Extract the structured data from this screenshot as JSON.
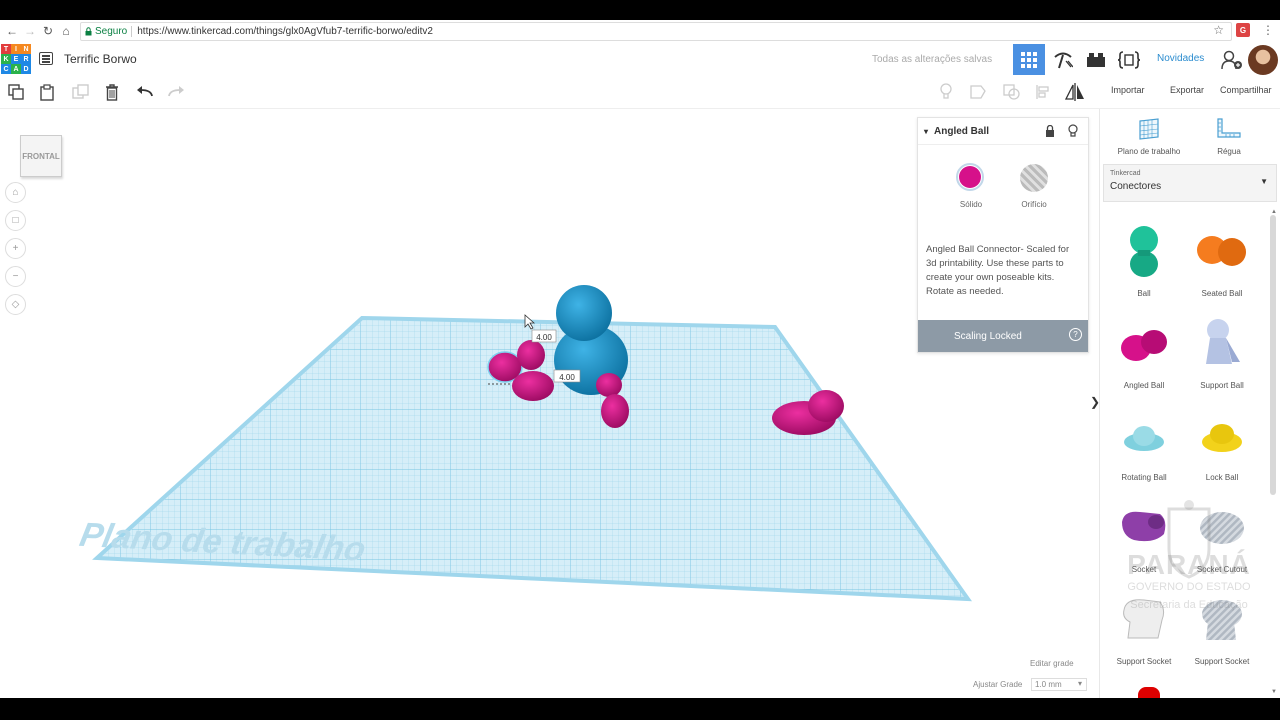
{
  "browser": {
    "secure_label": "Seguro",
    "url": "https://www.tinkercad.com/things/glx0AgVfub7-terrific-borwo/editv2"
  },
  "app": {
    "logo_letters": [
      "T",
      "I",
      "N",
      "K",
      "E",
      "R",
      "C",
      "A",
      "D"
    ],
    "project_title": "Terrific Borwo",
    "saved_status": "Todas as alterações salvas",
    "news_label": "Novidades"
  },
  "toolbar": {
    "import_label": "Importar",
    "export_label": "Exportar",
    "share_label": "Compartilhar"
  },
  "viewport": {
    "viewcube_label": "FRONTAL",
    "workplane_text": "Plano de trabalho",
    "dim_top": "4.00",
    "dim_side": "4.00",
    "edit_grid_label": "Editar grade",
    "adjust_grid_label": "Ajustar Grade",
    "grid_value": "1.0 mm"
  },
  "inspector": {
    "shape_name": "Angled Ball",
    "solid_label": "Sólido",
    "hole_label": "Orifício",
    "solid_color": "#d6118a",
    "description": "Angled Ball Connector- Scaled for 3d printability. Use these parts to create your own poseable kits. Rotate as needed.",
    "scaling_label": "Scaling Locked"
  },
  "panel": {
    "workplane_label": "Plano de trabalho",
    "ruler_label": "Régua",
    "library_source": "Tinkercad",
    "library_name": "Conectores",
    "shapes": [
      {
        "label": "Ball",
        "color": "#1fc29a"
      },
      {
        "label": "Seated Ball",
        "color": "#f57c1f"
      },
      {
        "label": "Angled Ball",
        "color": "#d6118a"
      },
      {
        "label": "Support Ball",
        "color": "#b9c7e6"
      },
      {
        "label": "Rotating Ball",
        "color": "#7fd0de"
      },
      {
        "label": "Lock Ball",
        "color": "#f2d21b"
      },
      {
        "label": "Socket",
        "color": "#8e3fa8"
      },
      {
        "label": "Socket Cutout",
        "color": "#b8bfc8"
      },
      {
        "label": "Support Socket",
        "color": "#e6e6e6"
      },
      {
        "label": "Support Socket",
        "color": "#b8bfc8"
      }
    ],
    "watermark_title": "PARANÁ",
    "watermark_sub1": "GOVERNO DO ESTADO",
    "watermark_sub2": "Secretaria da Educação"
  }
}
